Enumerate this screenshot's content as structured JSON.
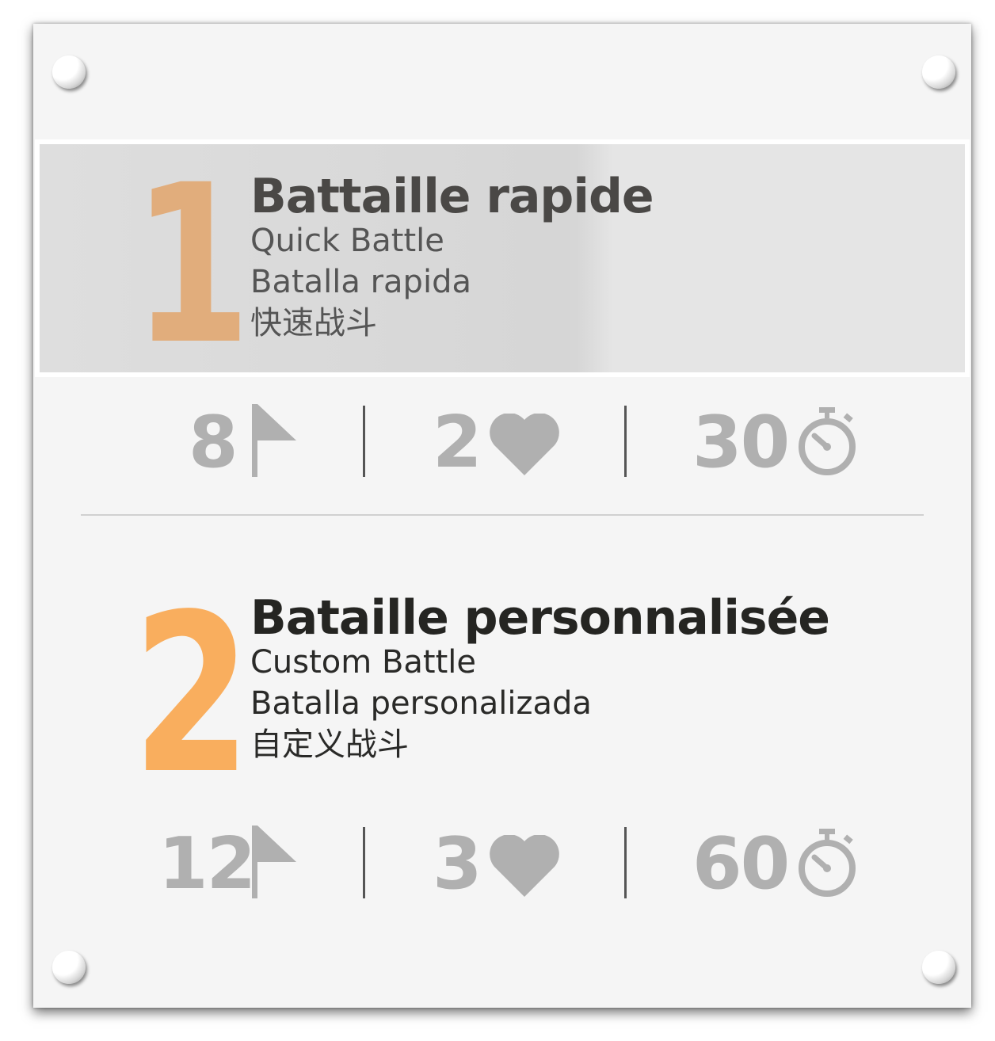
{
  "colors": {
    "accent_orange": "#f9ae5e",
    "accent_orange_muted": "#e1ad7c",
    "icon_gray": "#b0b0b0",
    "title_dark": "#252522"
  },
  "modes": [
    {
      "number": "1",
      "title": "Battaille rapide",
      "subtitle_en": "Quick Battle",
      "subtitle_es": "Batalla rapida",
      "subtitle_zh": "快速战斗",
      "selected": true,
      "stats": {
        "flags": "8",
        "lives": "2",
        "time": "30"
      },
      "icons": [
        "flag-icon",
        "heart-icon",
        "stopwatch-icon"
      ]
    },
    {
      "number": "2",
      "title": "Bataille personnalisée",
      "subtitle_en": "Custom Battle",
      "subtitle_es": "Batalla personalizada",
      "subtitle_zh": "自定义战斗",
      "selected": false,
      "stats": {
        "flags": "12",
        "lives": "3",
        "time": "60"
      },
      "icons": [
        "flag-icon",
        "heart-icon",
        "stopwatch-icon"
      ]
    }
  ]
}
